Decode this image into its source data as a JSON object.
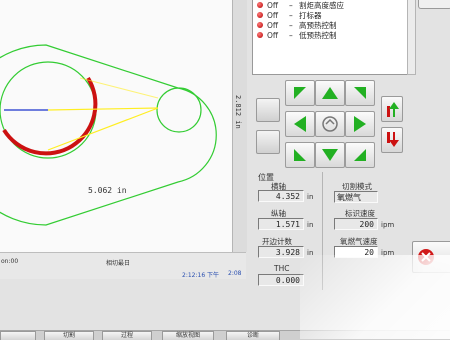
{
  "canvas": {
    "dimension_label": "5.062 in",
    "vertical_dimension": "2.812 in"
  },
  "status_bar": {
    "left_text": "on:00",
    "mid_text": "相切最日",
    "time_text": "2:12:16 下午",
    "right_text": "2:08"
  },
  "status_list": [
    {
      "state": "Off",
      "label": "割炬高度感应"
    },
    {
      "state": "Off",
      "label": "打标器"
    },
    {
      "state": "Off",
      "label": "高预热控制"
    },
    {
      "state": "Off",
      "label": "低预热控制"
    }
  ],
  "position_group": {
    "title": "位置",
    "fields": [
      {
        "label": "横轴",
        "value": "4.352",
        "unit": "in"
      },
      {
        "label": "纵轴",
        "value": "1.571",
        "unit": "in"
      },
      {
        "label": "开边计数",
        "value": "3.928",
        "unit": "in"
      },
      {
        "label": "THC",
        "value": "0.000",
        "unit": ""
      }
    ]
  },
  "cut_group": {
    "mode_label": "切割模式",
    "mode_value": "氧燃气",
    "cut_speed_label": "标识速度",
    "cut_speed_value": "200",
    "cut_speed_unit": "ipm",
    "gas_speed_label": "氧燃气速度",
    "gas_speed_value": "20",
    "gas_speed_unit": "ipm"
  },
  "bottom_buttons": [
    "",
    "切割",
    "过程",
    "缩放视图",
    "诊断"
  ],
  "colors": {
    "contour_green": "#33cc33",
    "arc_red": "#cc1111",
    "line_yellow": "#ffee22",
    "line_blue": "#1a33cc",
    "jog_arrow": "#22b022"
  },
  "icons": {
    "jog_up": "arrow-up-icon",
    "jog_down": "arrow-down-icon",
    "jog_left": "arrow-left-icon",
    "jog_right": "arrow-right-icon",
    "jog_home": "home-icon",
    "exit": "exit-icon"
  }
}
